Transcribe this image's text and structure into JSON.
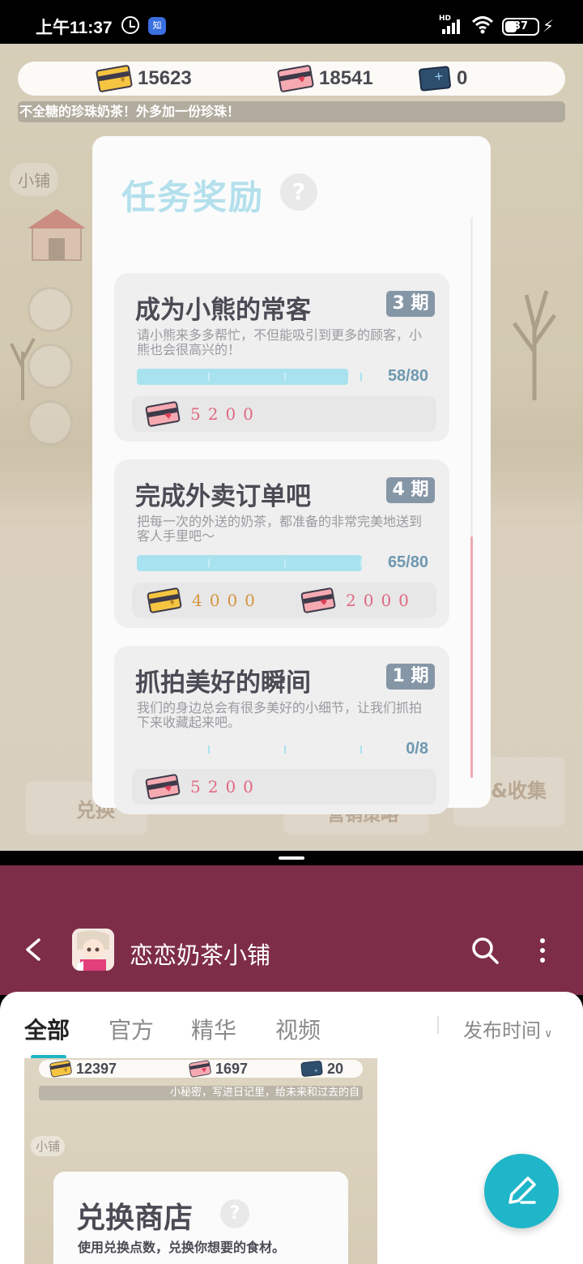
{
  "status_bar": {
    "time": "上午11:37",
    "app_badge": "知",
    "network": "HD",
    "battery": "37"
  },
  "game": {
    "currency": {
      "gold": "15623",
      "pink": "18541",
      "blue": "0"
    },
    "ticker": "不全糖的珍珠奶茶！外多加一份珍珠！",
    "shop_tag": "小铺",
    "bg_labels": [
      "兑换",
      "营销策略",
      "&收集"
    ],
    "panel": {
      "title": "任务奖励",
      "help": "?",
      "tasks": [
        {
          "title": "成为小熊的常客",
          "badge": "3 期",
          "desc": "请小熊来多多帮忙，不但能吸引到更多的顾客，小熊也会很高兴的！",
          "progress_text": "58/80",
          "progress": 0.94,
          "rewards": [
            {
              "type": "pink",
              "value": "5200"
            }
          ]
        },
        {
          "title": "完成外卖订单吧",
          "badge": "4 期",
          "desc": "把每一次的外送的奶茶，都准备的非常完美地送到客人手里吧～",
          "progress_text": "65/80",
          "progress": 1.0,
          "rewards": [
            {
              "type": "gold",
              "value": "4000"
            },
            {
              "type": "pink",
              "value": "2000"
            }
          ]
        },
        {
          "title": "抓拍美好的瞬间",
          "badge": "1 期",
          "desc": "我们的身边总会有很多美好的小细节，让我们抓拍下来收藏起来吧。",
          "progress_text": "0/8",
          "progress": 0.0,
          "rewards": [
            {
              "type": "pink",
              "value": "5200"
            }
          ]
        }
      ]
    }
  },
  "forum": {
    "app_name": "恋恋奶茶小铺",
    "tabs": [
      "全部",
      "官方",
      "精华",
      "视频"
    ],
    "active_tab": "全部",
    "sort_label": "发布时间",
    "thumbnail": {
      "currency": {
        "gold": "12397",
        "pink": "1697",
        "blue": "20"
      },
      "ticker": "小秘密，写进日记里，给未来和过去的自",
      "shop_tag": "小铺",
      "title": "兑换商店",
      "help": "?",
      "desc": "使用兑换点数，兑换你想要的食材。"
    }
  },
  "colors": {
    "forum_header": "#7e2d49",
    "accent": "#1fb6c9",
    "panel_title": "#b3e0ec",
    "badge": "#8596a6",
    "progress": "#a8e2ee",
    "reward_pink": "#e06a82",
    "reward_gold": "#d59640"
  }
}
